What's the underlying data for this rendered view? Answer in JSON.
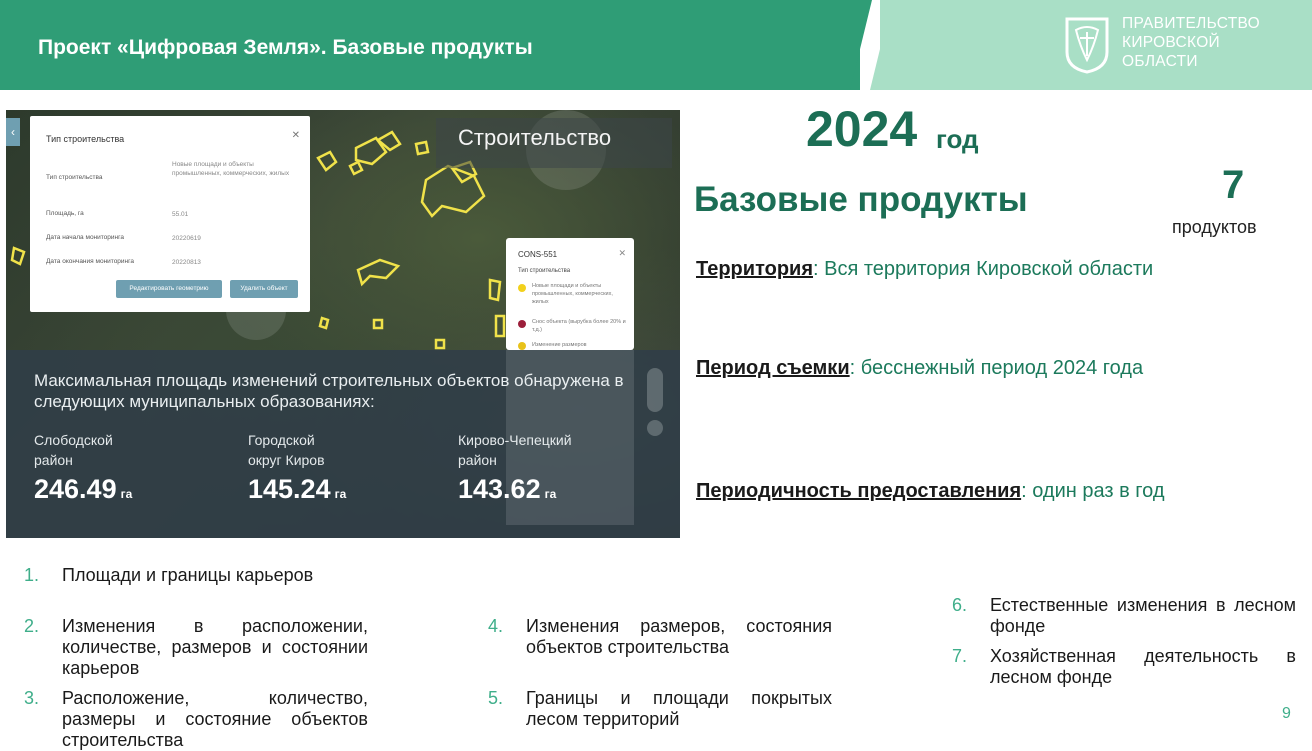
{
  "header": {
    "title": "Проект «Цифровая Земля». Базовые продукты",
    "org_lines": [
      "ПРАВИТЕЛЬСТВО",
      "КИРОВСКОЙ",
      "ОБЛАСТИ"
    ]
  },
  "map": {
    "tag": "Строительство",
    "popup": {
      "title": "Тип строительства",
      "rows": [
        {
          "label": "Тип строительства",
          "value": "Новые площади и объекты промышленных, коммерческих, жилых"
        },
        {
          "label": "Площадь, га",
          "value": "55.01"
        },
        {
          "label": "Дата начала мониторинга",
          "value": "20220619"
        },
        {
          "label": "Дата окончания мониторинга",
          "value": "20220813"
        }
      ],
      "buttons": [
        "Редактировать геометрию",
        "Удалить объект"
      ]
    },
    "legend": {
      "title": "CONS-551",
      "subtitle": "Тип строительства",
      "items": [
        {
          "label": "Новые площади и объекты промышленных, коммерческих, жилых",
          "color": "#f2d11c"
        },
        {
          "label": "Снос объекта (вырубка более 20% и т.д.)",
          "color": "#9c1f3b"
        },
        {
          "label": "Изменение размеров",
          "color": "#e8c21a"
        }
      ]
    },
    "overlay_text": "Максимальная площадь изменений строительных объектов обнаружена в следующих муниципальных образованиях:",
    "stats": [
      {
        "name_line1": "Слободской",
        "name_line2": "район",
        "value": "246.49",
        "unit": "га"
      },
      {
        "name_line1": "Городской",
        "name_line2": "округ Киров",
        "value": "145.24",
        "unit": "га"
      },
      {
        "name_line1": "Кирово-Чепецкий",
        "name_line2": "район",
        "value": "143.62",
        "unit": "га"
      }
    ]
  },
  "summary": {
    "year": "2024",
    "year_suffix": "год",
    "base_title": "Базовые продукты",
    "count": "7",
    "count_label": "продуктов",
    "territory_key": "Территория",
    "territory_value": ": Вся территория Кировской области",
    "period_key": "Период съемки",
    "period_value": ": бесснежный период 2024 года",
    "freq_key": "Периодичность предоставления",
    "freq_value": ": один раз в год"
  },
  "products": [
    {
      "n": "1.",
      "text": "Площади и границы карьеров"
    },
    {
      "n": "2.",
      "text": "Изменения в расположении, количестве, размеров и состоянии карьеров"
    },
    {
      "n": "3.",
      "text": "Расположение, количество, размеры и состояние объектов строительства"
    },
    {
      "n": "4.",
      "text": "Изменения размеров, состояния объектов строительства"
    },
    {
      "n": "5.",
      "text": "Границы и площади покрытых лесом территорий"
    },
    {
      "n": "6.",
      "text": "Естественные изменения в лесном фонде"
    },
    {
      "n": "7.",
      "text": "Хозяйственная деятельность в лесном фонде"
    }
  ],
  "page_number": "9",
  "colors": {
    "header_green": "#2f9d76",
    "header_light": "#a9dfc6",
    "accent_green": "#1c6e55"
  }
}
